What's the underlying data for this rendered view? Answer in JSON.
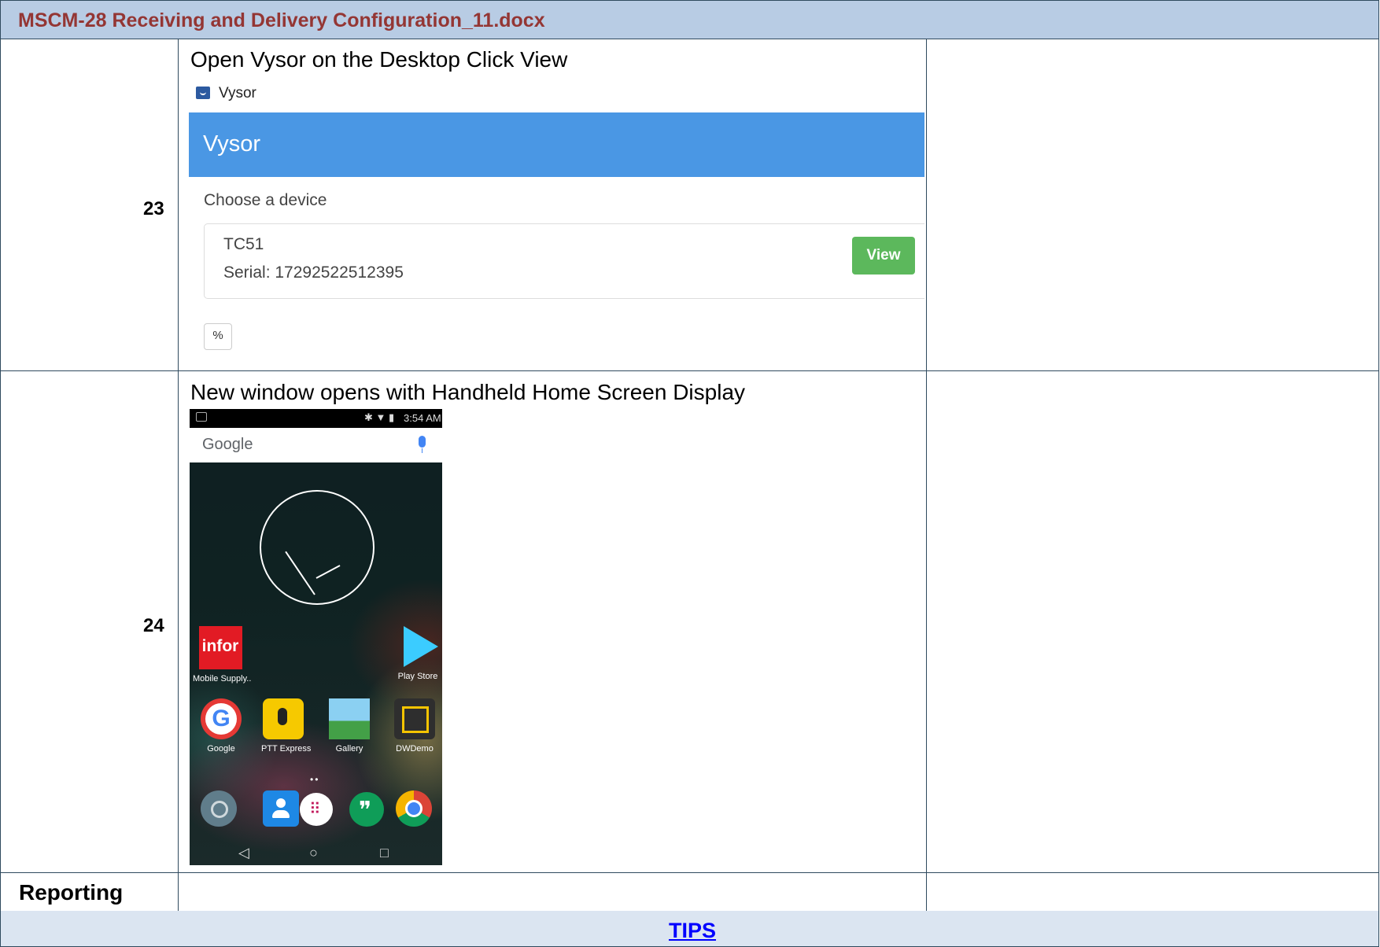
{
  "document": {
    "title": "MSCM-28 Receiving and Delivery Configuration_11.docx"
  },
  "rows": [
    {
      "number": "23",
      "instruction": "Open Vysor on the Desktop Click View"
    },
    {
      "number": "24",
      "instruction": "New window opens with Handheld Home Screen Display"
    }
  ],
  "reporting_label": "Reporting",
  "tips_link": "TIPS",
  "vysor": {
    "window_title": "Vysor",
    "header_title": "Vysor",
    "choose_label": "Choose a device",
    "device_model": "TC51",
    "device_serial": "Serial: 17292522512395",
    "view_button": "View",
    "link_icon_glyph": "%",
    "colors": {
      "header": "#4a97e4",
      "view_button": "#5cb85c"
    }
  },
  "phone": {
    "status_time": "3:54 AM",
    "status_icons": "✱ ▼ ▮",
    "search_brand": "Google",
    "apps_row1": [
      {
        "label": "Mobile Supply..",
        "icon_text": "infor",
        "icon": "infor-icon"
      },
      {
        "label": "Play Store",
        "icon": "play-store-icon"
      }
    ],
    "apps_row2": [
      {
        "label": "Google",
        "icon": "google-icon"
      },
      {
        "label": "PTT Express",
        "icon": "ptt-express-icon"
      },
      {
        "label": "Gallery",
        "icon": "gallery-icon"
      },
      {
        "label": "DWDemo",
        "icon": "dwdemo-icon"
      }
    ],
    "page_dots": "••",
    "dock": [
      "settings-icon",
      "contacts-icon",
      "app-drawer-icon",
      "hangouts-icon",
      "chrome-icon"
    ],
    "dock_glyphs": {
      "app_drawer": "⠿",
      "hangouts": "❞"
    },
    "nav": {
      "back": "◁",
      "home": "○",
      "recents": "□"
    }
  },
  "colors": {
    "title_bar": "#b8cce4",
    "title_text": "#943634",
    "tips_row": "#dbe5f1",
    "link": "#0000ff"
  }
}
